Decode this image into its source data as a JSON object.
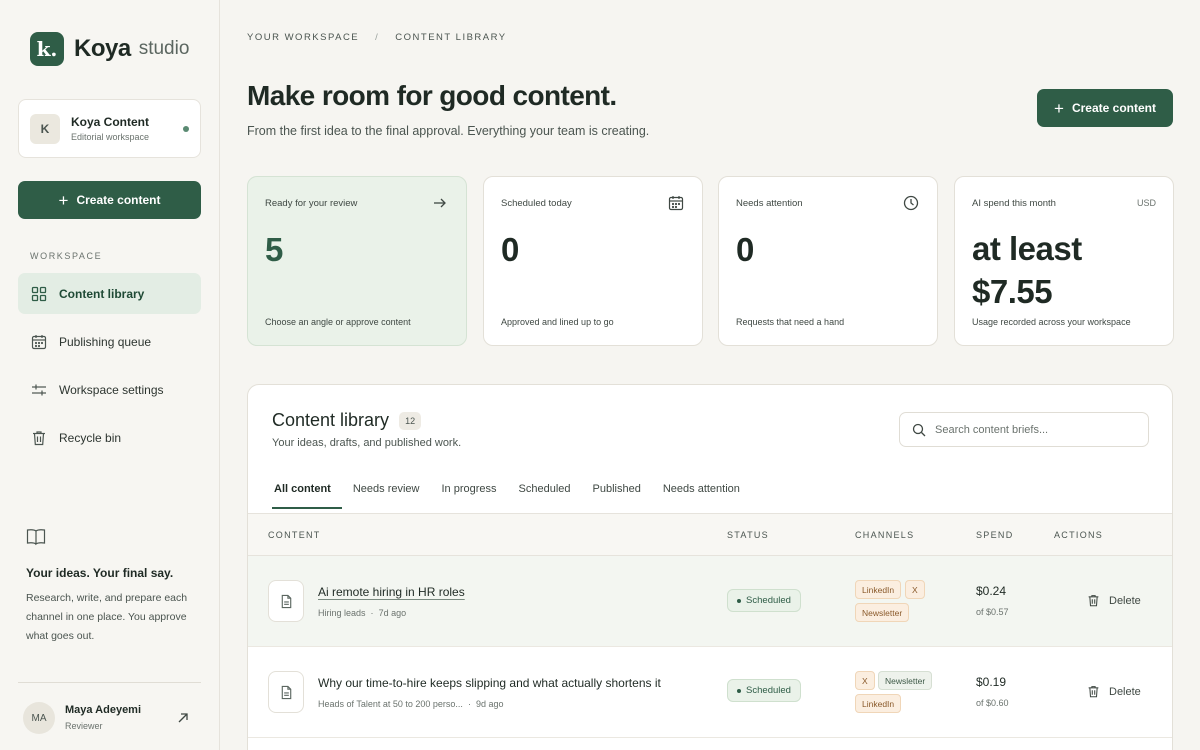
{
  "brand": {
    "mark": "k.",
    "name": "Koya",
    "sub": "studio"
  },
  "workspace_card": {
    "avatar": "K",
    "name": "Koya Content",
    "subtitle": "Editorial workspace"
  },
  "sidebar": {
    "create_label": "Create content",
    "section_label": "WORKSPACE",
    "items": [
      {
        "label": "Content library",
        "icon": "grid-icon",
        "active": true
      },
      {
        "label": "Publishing queue",
        "icon": "calendar-icon",
        "active": false
      },
      {
        "label": "Workspace settings",
        "icon": "sliders-icon",
        "active": false
      },
      {
        "label": "Recycle bin",
        "icon": "trash-icon",
        "active": false
      }
    ],
    "promo_title": "Your ideas. Your final say.",
    "promo_text": "Research, write, and prepare each channel in one place. You approve what goes out.",
    "user": {
      "initials": "MA",
      "name": "Maya Adeyemi",
      "role": "Reviewer"
    }
  },
  "header": {
    "breadcrumb": [
      "YOUR WORKSPACE",
      "/",
      "CONTENT LIBRARY"
    ],
    "title": "Make room for good content.",
    "subtitle": "From the first idea to the final approval. Everything your team is creating.",
    "create_label": "Create content"
  },
  "stats": [
    {
      "label": "Ready for your review",
      "value": "5",
      "footer": "Choose an angle or approve content",
      "icon": "arrow-right-icon"
    },
    {
      "label": "Scheduled today",
      "value": "0",
      "footer": "Approved and lined up to go",
      "icon": "calendar-icon"
    },
    {
      "label": "Needs attention",
      "value": "0",
      "footer": "Requests that need a hand",
      "icon": "clock-icon"
    },
    {
      "label": "AI spend this month",
      "currency": "USD",
      "value_line1": "at least",
      "value_line2": "$7.55",
      "footer": "Usage recorded across your workspace"
    }
  ],
  "library": {
    "title": "Content library",
    "count": "12",
    "subtitle": "Your ideas, drafts, and published work.",
    "search_placeholder": "Search content briefs...",
    "tabs": [
      "All content",
      "Needs review",
      "In progress",
      "Scheduled",
      "Published",
      "Needs attention"
    ],
    "columns": [
      "CONTENT",
      "STATUS",
      "CHANNELS",
      "SPEND",
      "ACTIONS"
    ],
    "rows": [
      {
        "title": "Ai remote hiring in HR roles",
        "meta_audience": "Hiring leads",
        "meta_sep": "·",
        "meta_age": "7d ago",
        "status": "Scheduled",
        "channels": [
          "LinkedIn",
          "X",
          "Newsletter"
        ],
        "spend": "$0.24",
        "spend_of": "of $0.57",
        "action": "Delete"
      },
      {
        "title": "Why our time-to-hire keeps slipping and what actually shortens it",
        "meta_audience": "Heads of Talent at 50 to 200 perso...",
        "meta_sep": "·",
        "meta_age": "9d ago",
        "status": "Scheduled",
        "channels": [
          "X",
          "Newsletter",
          "LinkedIn"
        ],
        "spend": "$0.19",
        "spend_of": "of $0.60",
        "action": "Delete"
      }
    ]
  },
  "colors": {
    "accent": "#2f5d47",
    "background": "#f6f5f1",
    "chip_orange": "#fbeee0"
  }
}
